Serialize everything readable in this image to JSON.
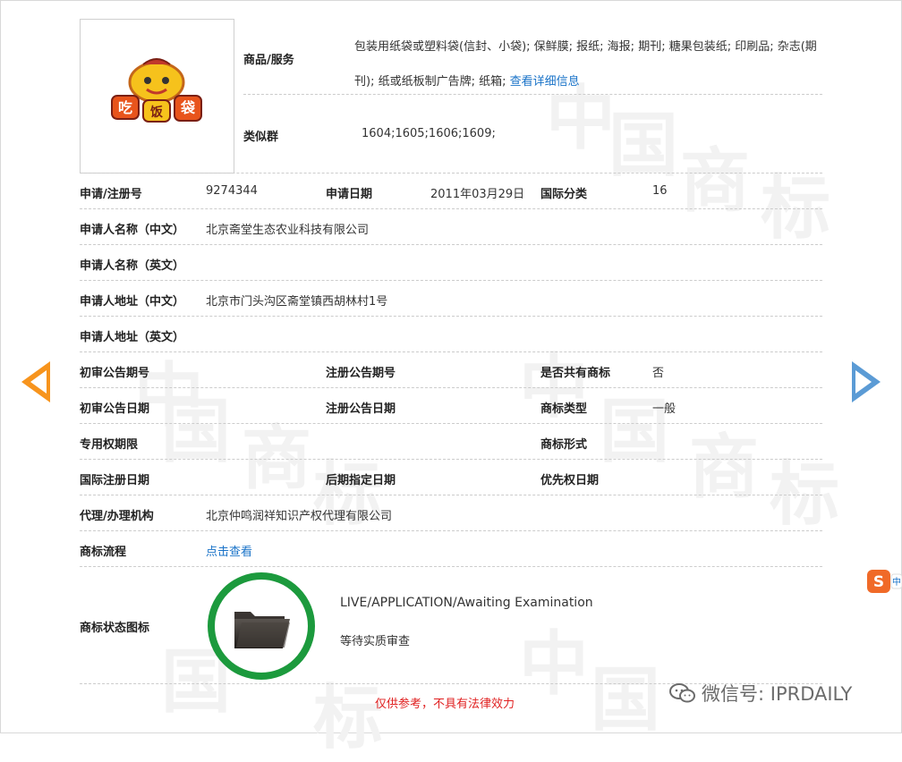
{
  "trademark": {
    "goods_label": "商品/服务",
    "goods_text": "包装用纸袋或塑料袋(信封、小袋); 保鲜膜; 报纸; 海报; 期刊; 糖果包装纸; 印刷品; 杂志(期刊); 纸或纸板制广告牌; 纸箱;",
    "goods_link": "查看详细信息",
    "similar_group_label": "类似群",
    "similar_group_value": "1604;1605;1606;1609;",
    "logo_text": "吃饭袋"
  },
  "rows": [
    {
      "label": "申请/注册号",
      "value": "9274344",
      "label2": "申请日期",
      "value2": "2011年03月29日",
      "label3": "国际分类",
      "value3": "16"
    },
    {
      "label": "申请人名称（中文）",
      "value": "北京斋堂生态农业科技有限公司"
    },
    {
      "label": "申请人名称（英文）",
      "value": ""
    },
    {
      "label": "申请人地址（中文）",
      "value": "北京市门头沟区斋堂镇西胡林村1号"
    },
    {
      "label": "申请人地址（英文）",
      "value": ""
    },
    {
      "label": "初审公告期号",
      "value": "",
      "label2": "注册公告期号",
      "value2": "",
      "label3": "是否共有商标",
      "value3": "否"
    },
    {
      "label": "初审公告日期",
      "value": "",
      "label2": "注册公告日期",
      "value2": "",
      "label3": "商标类型",
      "value3": "一般"
    },
    {
      "label": "专用权期限",
      "value": "",
      "label3": "商标形式",
      "value3": ""
    },
    {
      "label": "国际注册日期",
      "value": "",
      "label2": "后期指定日期",
      "value2": "",
      "label3": "优先权日期",
      "value3": ""
    },
    {
      "label": "代理/办理机构",
      "value": "北京仲鸣润祥知识产权代理有限公司"
    },
    {
      "label": "商标流程",
      "link": "点击查看"
    }
  ],
  "status": {
    "label": "商标状态图标",
    "english": "LIVE/APPLICATION/Awaiting Examination",
    "chinese": "等待实质审查",
    "ring_color": "#1c9a3d"
  },
  "disclaimer": "仅供参考，不具有法律效力",
  "wechat": "微信号: IPRDAILY",
  "watermark": "中国商标",
  "colors": {
    "accent_link": "#1a73c8",
    "arrow_left": "#f7941d",
    "arrow_right": "#5b9bd5",
    "warning": "#e02020"
  },
  "icons": [
    "arrow-left-icon",
    "arrow-right-icon",
    "folder-icon",
    "sogou-icon",
    "wechat-icon"
  ]
}
